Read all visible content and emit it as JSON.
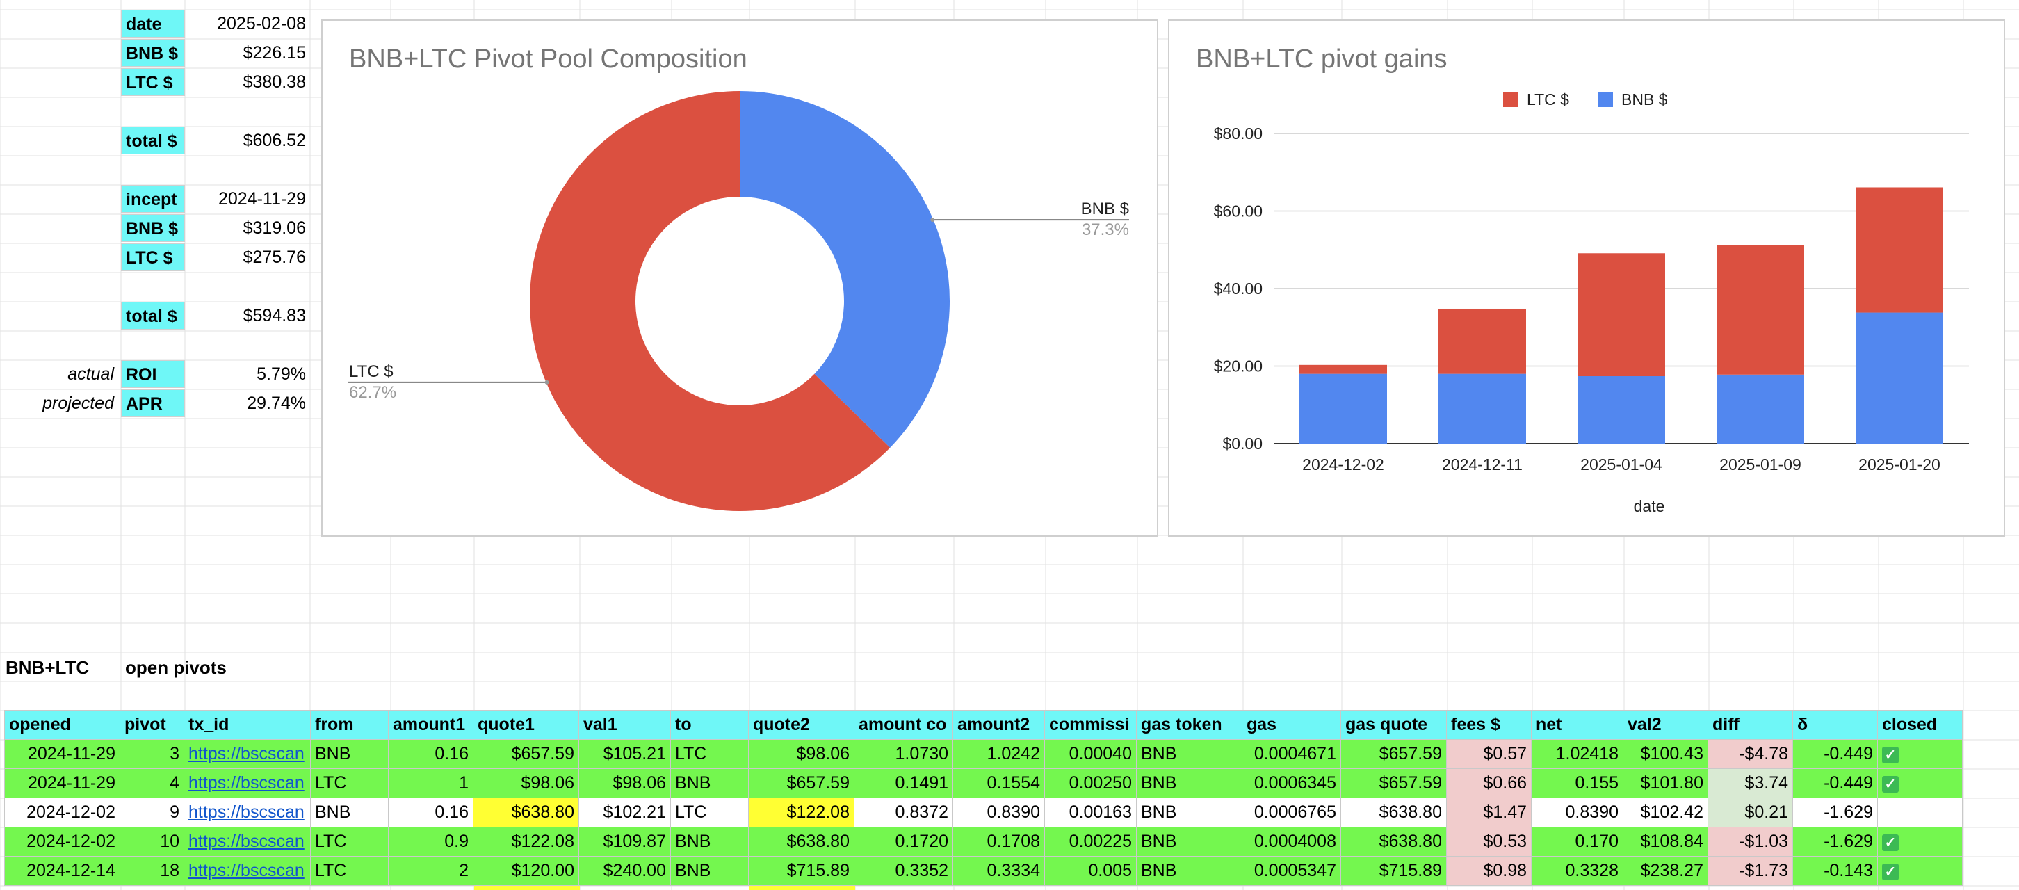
{
  "summary": {
    "current": [
      {
        "label": "date",
        "value": "2025-02-08"
      },
      {
        "label": "BNB $",
        "value": "$226.15"
      },
      {
        "label": "LTC $",
        "value": "$380.38"
      }
    ],
    "current_total": {
      "label": "total $",
      "value": "$606.52"
    },
    "incept": [
      {
        "label": "incept",
        "value": "2024-11-29"
      },
      {
        "label": "BNB $",
        "value": "$319.06"
      },
      {
        "label": "LTC $",
        "value": "$275.76"
      }
    ],
    "incept_total": {
      "label": "total $",
      "value": "$594.83"
    },
    "roi": {
      "note": "actual",
      "label": "ROI",
      "value": "5.79%"
    },
    "apr": {
      "note": "projected",
      "label": "APR",
      "value": "29.74%"
    }
  },
  "sections": {
    "pair": "BNB+LTC",
    "open_pivots": "open pivots"
  },
  "colors": {
    "ltc": "#db5040",
    "bnb": "#5287ef",
    "header": "#6ff7f7",
    "row": "#74f74f",
    "highlight": "#ffff33",
    "fees": "#f1cccc"
  },
  "chart_data": [
    {
      "type": "pie",
      "variant": "donut",
      "title": "BNB+LTC Pivot Pool Composition",
      "slices": [
        {
          "name": "BNB $",
          "value": 37.3,
          "label": "37.3%",
          "color": "#5287ef"
        },
        {
          "name": "LTC $",
          "value": 62.7,
          "label": "62.7%",
          "color": "#db5040"
        }
      ]
    },
    {
      "type": "bar",
      "stacked": true,
      "title": "BNB+LTC pivot gains",
      "xlabel": "date",
      "ylabel": "",
      "categories": [
        "2024-12-02",
        "2024-12-11",
        "2025-01-04",
        "2025-01-09",
        "2025-01-20"
      ],
      "series": [
        {
          "name": "BNB $",
          "color": "#5287ef",
          "values": [
            18.0,
            18.0,
            17.4,
            17.8,
            33.8
          ]
        },
        {
          "name": "LTC $",
          "color": "#db5040",
          "values": [
            2.3,
            16.8,
            31.7,
            33.5,
            32.3
          ]
        }
      ],
      "legend_order": [
        "LTC $",
        "BNB $"
      ],
      "legend": "top",
      "ylim": [
        0,
        80
      ],
      "yticks": [
        "$0.00",
        "$20.00",
        "$40.00",
        "$60.00",
        "$80.00"
      ],
      "grid": true
    }
  ],
  "table": {
    "columns": [
      "opened",
      "pivot",
      "tx_id",
      "from",
      "amount1",
      "quote1",
      "val1",
      "to",
      "quote2",
      "amount co",
      "amount2",
      "commissi",
      "gas token",
      "gas",
      "gas quote",
      "fees $",
      "net",
      "val2",
      "diff",
      "δ",
      "closed"
    ],
    "rows": [
      {
        "opened": "2024-11-29",
        "pivot": "3",
        "tx_id": "https://bscscan",
        "from": "BNB",
        "amount1": "0.16",
        "quote1": "$657.59",
        "val1": "$105.21",
        "to": "LTC",
        "quote2": "$98.06",
        "amount_co": "1.0730",
        "amount2": "1.0242",
        "commission": "0.00040",
        "gas_token": "BNB",
        "gas": "0.0004671",
        "gas_quote": "$657.59",
        "fees": "$0.57",
        "net": "1.02418",
        "val2": "$100.43",
        "diff": "-$4.78",
        "delta": "-0.449",
        "closed": true
      },
      {
        "opened": "2024-11-29",
        "pivot": "4",
        "tx_id": "https://bscscan",
        "from": "LTC",
        "amount1": "1",
        "quote1": "$98.06",
        "val1": "$98.06",
        "to": "BNB",
        "quote2": "$657.59",
        "amount_co": "0.1491",
        "amount2": "0.1554",
        "commission": "0.00250",
        "gas_token": "BNB",
        "gas": "0.0006345",
        "gas_quote": "$657.59",
        "fees": "$0.66",
        "net": "0.155",
        "val2": "$101.80",
        "diff": "$3.74",
        "delta": "-0.449",
        "closed": true
      },
      {
        "opened": "2024-12-02",
        "pivot": "9",
        "tx_id": "https://bscscan",
        "from": "BNB",
        "amount1": "0.16",
        "quote1": "$638.80",
        "val1": "$102.21",
        "to": "LTC",
        "quote2": "$122.08",
        "amount_co": "0.8372",
        "amount2": "0.8390",
        "commission": "0.00163",
        "gas_token": "BNB",
        "gas": "0.0006765",
        "gas_quote": "$638.80",
        "fees": "$1.47",
        "net": "0.8390",
        "val2": "$102.42",
        "diff": "$0.21",
        "delta": "-1.629",
        "closed": false
      },
      {
        "opened": "2024-12-02",
        "pivot": "10",
        "tx_id": "https://bscscan",
        "from": "LTC",
        "amount1": "0.9",
        "quote1": "$122.08",
        "val1": "$109.87",
        "to": "BNB",
        "quote2": "$638.80",
        "amount_co": "0.1720",
        "amount2": "0.1708",
        "commission": "0.00225",
        "gas_token": "BNB",
        "gas": "0.0004008",
        "gas_quote": "$638.80",
        "fees": "$0.53",
        "net": "0.170",
        "val2": "$108.84",
        "diff": "-$1.03",
        "delta": "-1.629",
        "closed": true
      },
      {
        "opened": "2024-12-14",
        "pivot": "18",
        "tx_id": "https://bscscan",
        "from": "LTC",
        "amount1": "2",
        "quote1": "$120.00",
        "val1": "$240.00",
        "to": "BNB",
        "quote2": "$715.89",
        "amount_co": "0.3352",
        "amount2": "0.3334",
        "commission": "0.005",
        "gas_token": "BNB",
        "gas": "0.0005347",
        "gas_quote": "$715.89",
        "fees": "$0.98",
        "net": "0.3328",
        "val2": "$238.27",
        "diff": "-$1.73",
        "delta": "-0.143",
        "closed": true
      }
    ]
  }
}
